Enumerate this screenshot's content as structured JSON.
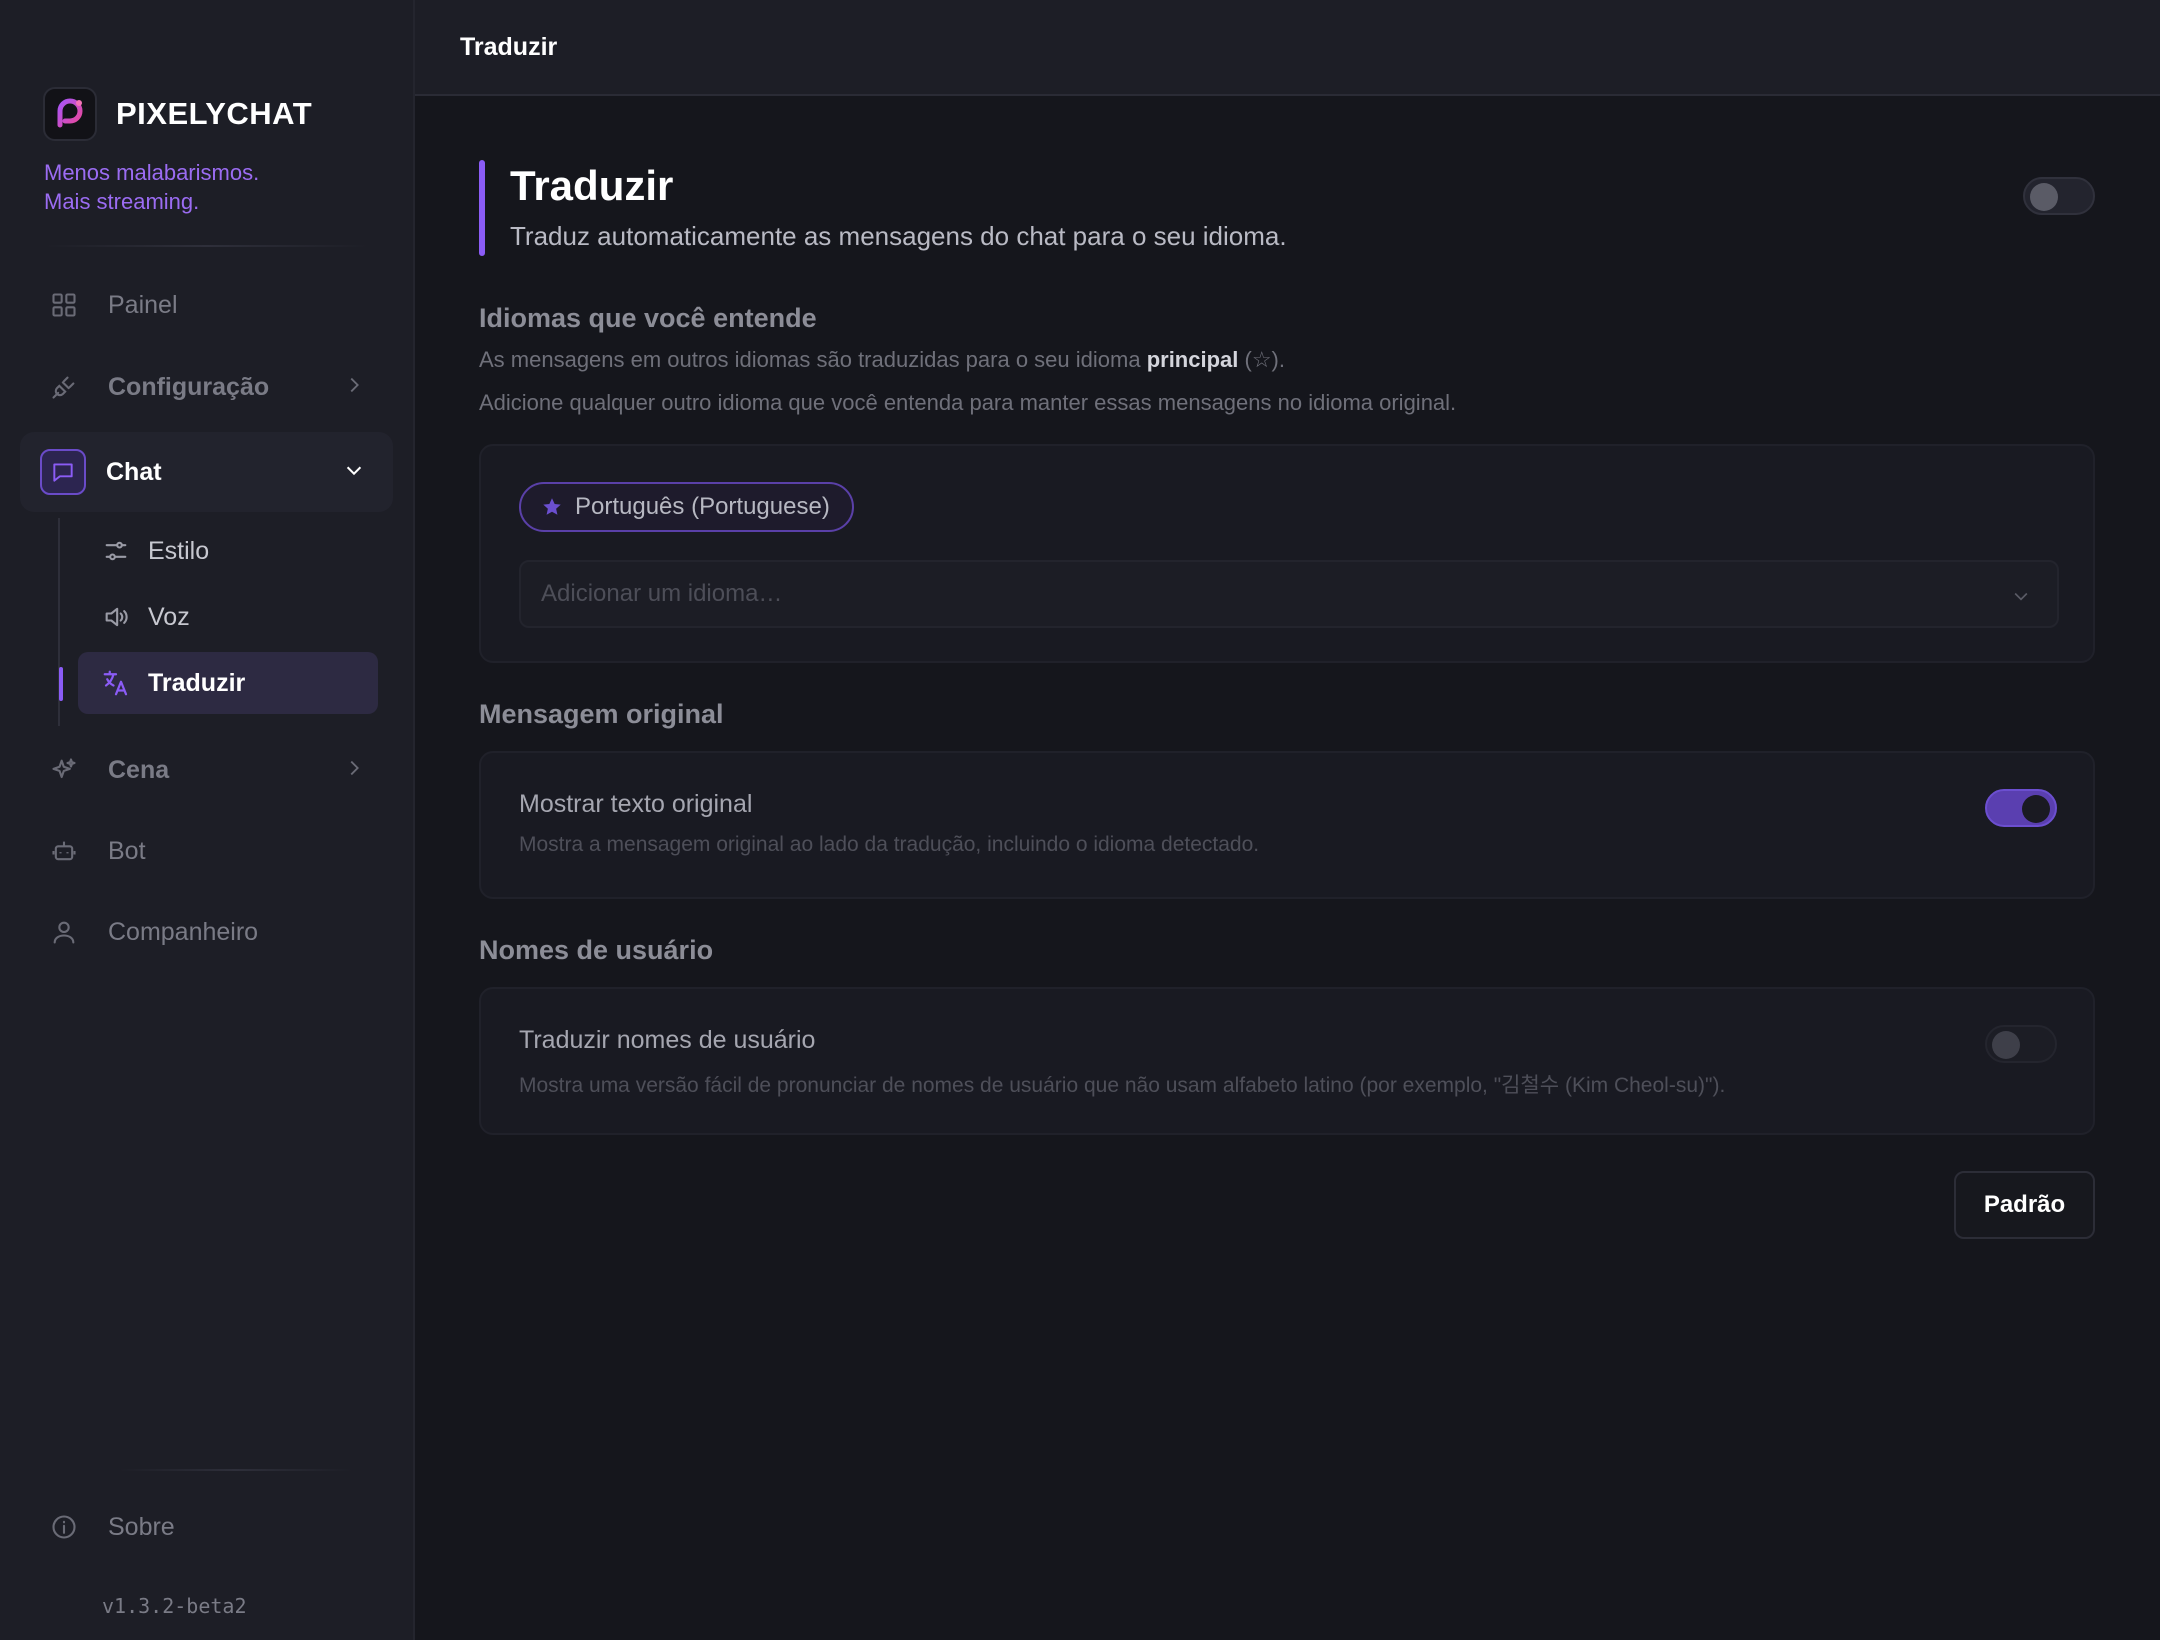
{
  "app": {
    "name": "PIXELYCHAT",
    "tagline_line1": "Menos malabarismos.",
    "tagline_line2": "Mais streaming.",
    "version": "v1.3.2-beta2"
  },
  "sidebar": {
    "items": [
      {
        "label": "Painel",
        "icon": "grid-icon"
      },
      {
        "label": "Configuração",
        "icon": "plug-icon"
      },
      {
        "label": "Chat",
        "icon": "chat-bubble-icon"
      },
      {
        "label": "Cena",
        "icon": "sparkles-icon"
      },
      {
        "label": "Bot",
        "icon": "robot-icon"
      },
      {
        "label": "Companheiro",
        "icon": "user-icon"
      }
    ],
    "chat_sub": [
      {
        "label": "Estilo",
        "icon": "sliders-icon"
      },
      {
        "label": "Voz",
        "icon": "speaker-icon"
      },
      {
        "label": "Traduzir",
        "icon": "translate-icon"
      }
    ],
    "about": "Sobre"
  },
  "topbar": {
    "title": "Traduzir"
  },
  "header": {
    "title": "Traduzir",
    "description": "Traduz automaticamente as mensagens do chat para o seu idioma.",
    "enabled": false
  },
  "languages": {
    "title": "Idiomas que você entende",
    "desc1_before": "As mensagens em outros idiomas são traduzidas para o seu idioma ",
    "desc1_bold": "principal",
    "desc1_after": " (☆).",
    "desc2": "Adicione qualquer outro idioma que você entenda para manter essas mensagens no idioma original.",
    "primary_language": "Português (Portuguese)",
    "add_placeholder": "Adicionar um idioma…"
  },
  "original_message": {
    "title": "Mensagem original",
    "option_title": "Mostrar texto original",
    "option_desc": "Mostra a mensagem original ao lado da tradução, incluindo o idioma detectado.",
    "enabled": true
  },
  "usernames": {
    "title": "Nomes de usuário",
    "option_title": "Traduzir nomes de usuário",
    "option_desc": "Mostra uma versão fácil de pronunciar de nomes de usuário que não usam alfabeto latino (por exemplo, \"김철수 (Kim Cheol-su)\").",
    "enabled": false
  },
  "buttons": {
    "default": "Padrão"
  },
  "colors": {
    "accent": "#8b5cf6",
    "background": "#15161c",
    "sidebar": "#1d1e26"
  }
}
